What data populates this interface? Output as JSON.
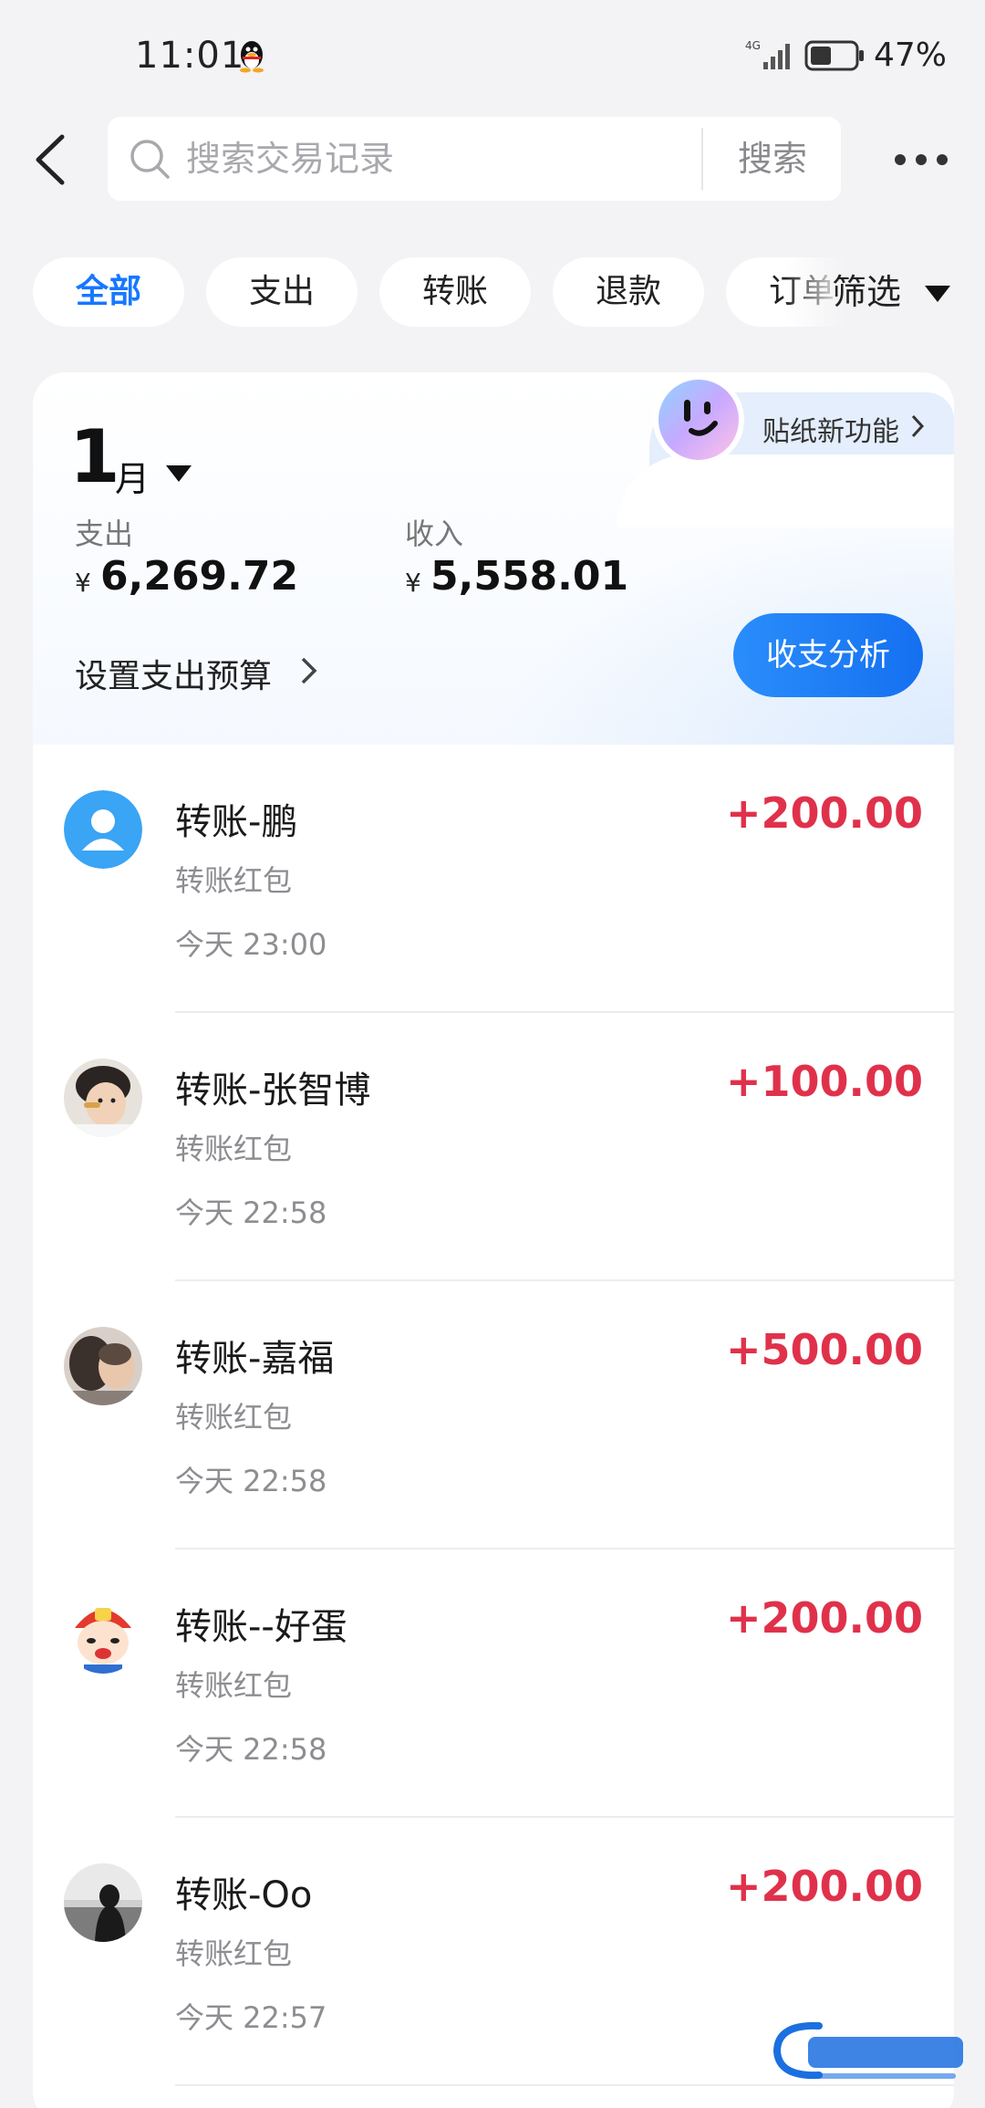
{
  "status_bar": {
    "time": "11:01",
    "network": "4G",
    "battery": "47%"
  },
  "header": {
    "search_placeholder": "搜索交易记录",
    "search_button": "搜索"
  },
  "filters": {
    "chips": [
      "全部",
      "支出",
      "转账",
      "退款",
      "订单"
    ],
    "active": "全部",
    "filter_label": "筛选"
  },
  "summary": {
    "sticker_label": "贴纸新功能",
    "month_number": "1",
    "month_unit": "月",
    "expense_label": "支出",
    "expense_currency": "¥",
    "expense_value": "6,269.72",
    "income_label": "收入",
    "income_currency": "¥",
    "income_value": "5,558.01",
    "budget_label": "设置支出预算",
    "analysis_button": "收支分析"
  },
  "transactions": [
    {
      "title": "转账-鹏",
      "subtitle": "转账红包",
      "time": "今天 23:00",
      "amount": "+200.00",
      "avatar": "default-user-icon"
    },
    {
      "title": "转账-张智博",
      "subtitle": "转账红包",
      "time": "今天 22:58",
      "amount": "+100.00",
      "avatar": "photo-child"
    },
    {
      "title": "转账-嘉福",
      "subtitle": "转账红包",
      "time": "今天 22:58",
      "amount": "+500.00",
      "avatar": "photo-couple"
    },
    {
      "title": "转账--好蛋",
      "subtitle": "转账红包",
      "time": "今天 22:58",
      "amount": "+200.00",
      "avatar": "cartoon-red-hat"
    },
    {
      "title": "转账-Oo",
      "subtitle": "转账红包",
      "time": "今天 22:57",
      "amount": "+200.00",
      "avatar": "photo-silhouette"
    }
  ],
  "colors": {
    "accent": "#1677ff",
    "income": "#e0314b",
    "background": "#f3f3f5"
  }
}
